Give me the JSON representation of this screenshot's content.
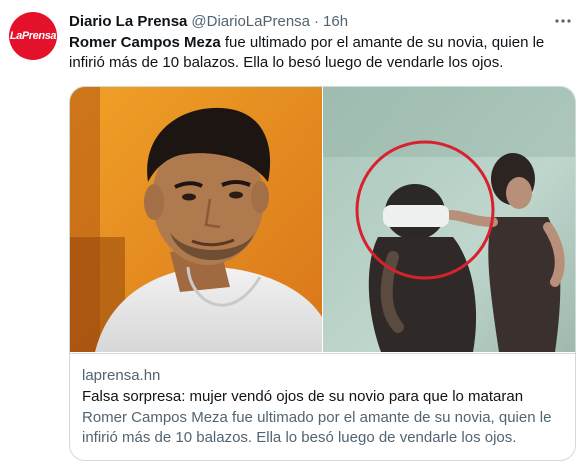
{
  "account": {
    "avatar_text": "LaPrensa",
    "display_name": "Diario La Prensa",
    "handle": "@DiarioLaPrensa",
    "separator": "·",
    "time": "16h",
    "avatar_color": "#e3122a"
  },
  "tweet": {
    "text_bold": "Romer Campos Meza",
    "text_rest": " fue ultimado por el amante de su novia, quien le infirió más de 10 balazos. Ella lo besó luego de vendarle los ojos."
  },
  "card": {
    "domain": "laprensa.hn",
    "title": "Falsa sorpresa: mujer vendó ojos de su novio para que lo mataran",
    "description": "Romer Campos Meza fue ultimado por el amante de su novia, quien le infirió más de 10 balazos. Ella lo besó luego de vendarle los ojos."
  },
  "icons": {
    "more": "more-horizontal-icon"
  },
  "colors": {
    "text_primary": "#0f1419",
    "text_secondary": "#536471",
    "border": "#cfd9de",
    "highlight_circle": "#d8212f"
  }
}
